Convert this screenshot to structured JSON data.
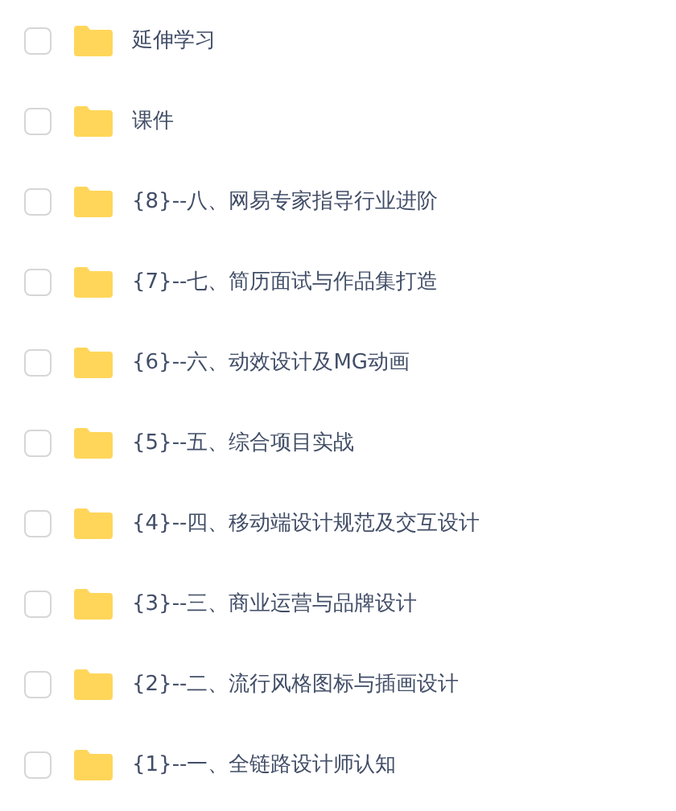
{
  "files": [
    {
      "name": "延伸学习",
      "checked": false
    },
    {
      "name": "课件",
      "checked": false
    },
    {
      "name": "{8}--八、网易专家指导行业进阶",
      "checked": false
    },
    {
      "name": "{7}--七、简历面试与作品集打造",
      "checked": false
    },
    {
      "name": "{6}--六、动效设计及MG动画",
      "checked": false
    },
    {
      "name": "{5}--五、综合项目实战",
      "checked": false
    },
    {
      "name": "{4}--四、移动端设计规范及交互设计",
      "checked": false
    },
    {
      "name": "{3}--三、商业运营与品牌设计",
      "checked": false
    },
    {
      "name": "{2}--二、流行风格图标与插画设计",
      "checked": false
    },
    {
      "name": "{1}--一、全链路设计师认知",
      "checked": false
    }
  ]
}
